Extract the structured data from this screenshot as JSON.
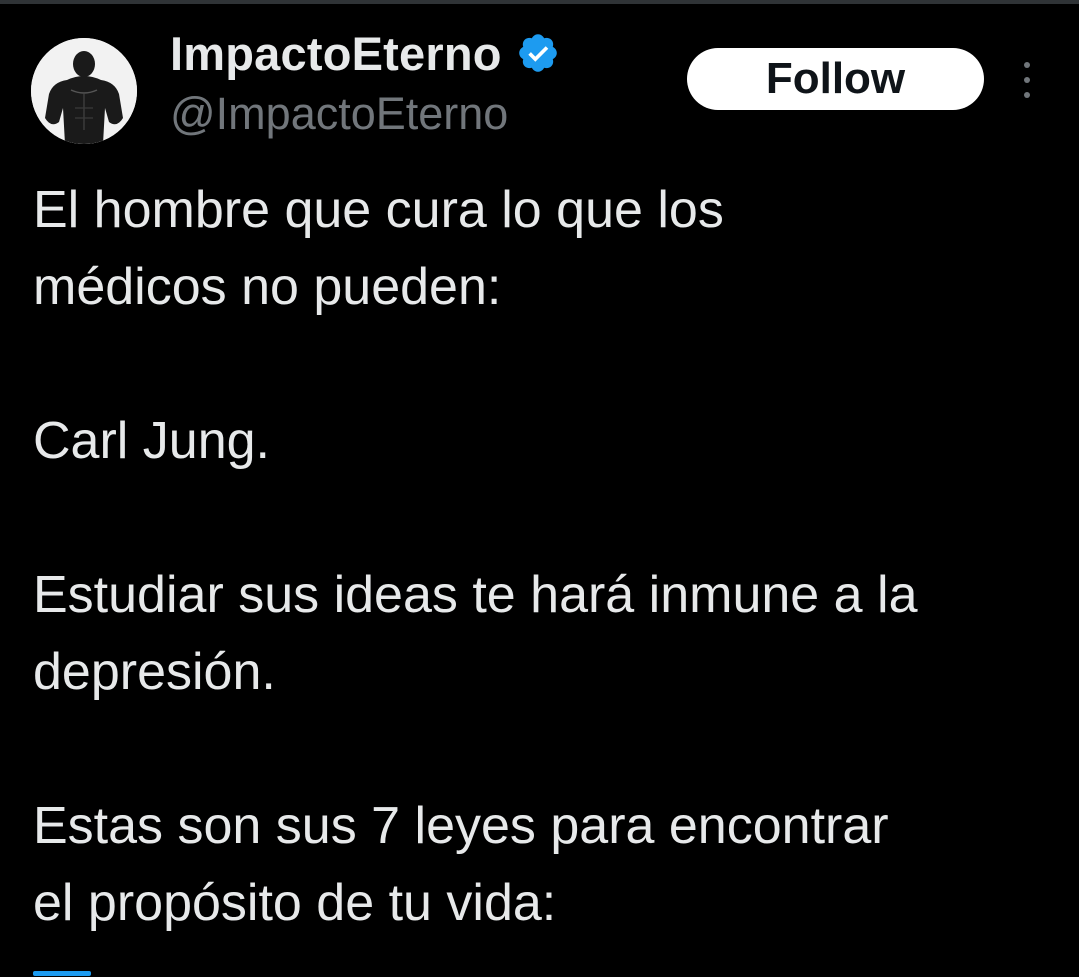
{
  "author": {
    "display_name": "ImpactoEterno",
    "handle": "@ImpactoEterno",
    "verified": true,
    "avatar_icon": "muscular-man-silhouette-icon",
    "verified_icon": "verified-badge-icon"
  },
  "actions": {
    "follow_label": "Follow",
    "more_icon": "more-vertical-icon"
  },
  "tweet": {
    "lines": [
      "El hombre que cura lo que los",
      "médicos no pueden:",
      "",
      "Carl Jung.",
      "",
      "Estudiar sus ideas te hará inmune a la",
      "depresión.",
      "",
      "Estas son sus 7 leyes para encontrar",
      "el propósito de tu vida:"
    ]
  },
  "colors": {
    "background": "#000000",
    "text_primary": "#e7e9ea",
    "text_secondary": "#71767b",
    "accent": "#1d9bf0",
    "follow_bg": "#ffffff",
    "follow_text": "#0f1419"
  }
}
